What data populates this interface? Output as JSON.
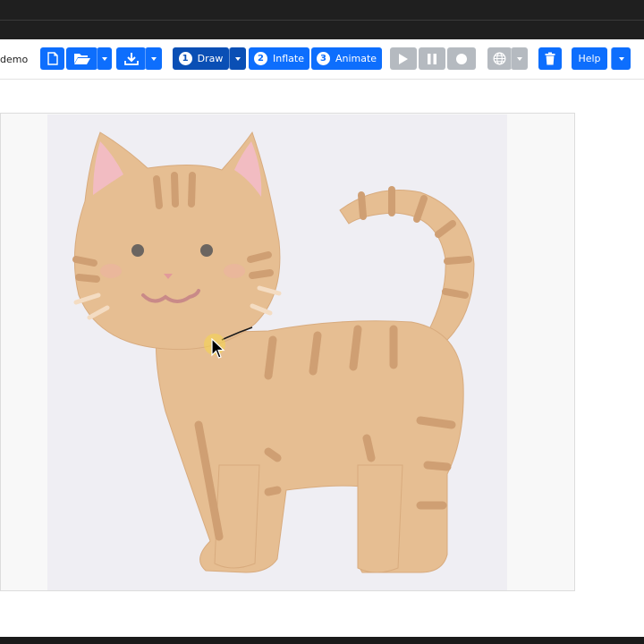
{
  "app": {
    "name": "demo"
  },
  "toolbar": {
    "new_icon": "file-icon",
    "open_icon": "folder-open-icon",
    "save_icon": "download-icon",
    "steps": [
      {
        "number": "1",
        "label": "Draw"
      },
      {
        "number": "2",
        "label": "Inflate"
      },
      {
        "number": "3",
        "label": "Animate"
      }
    ],
    "play_icon": "play-icon",
    "pause_icon": "pause-icon",
    "record_icon": "record-icon",
    "language_icon": "globe-icon",
    "delete_icon": "trash-icon",
    "help_label": "Help"
  },
  "colors": {
    "primary": "#0d6efd",
    "active_step": "#0a4fb5",
    "disabled": "#b5bac0",
    "topbar": "#1f1f1f",
    "canvas_bg": "#efeef3",
    "cat_fur": "#e6be92",
    "cat_stripe": "#cf9f73"
  },
  "canvas": {
    "content": "cat-drawing",
    "cursor": "arrow-cursor"
  }
}
